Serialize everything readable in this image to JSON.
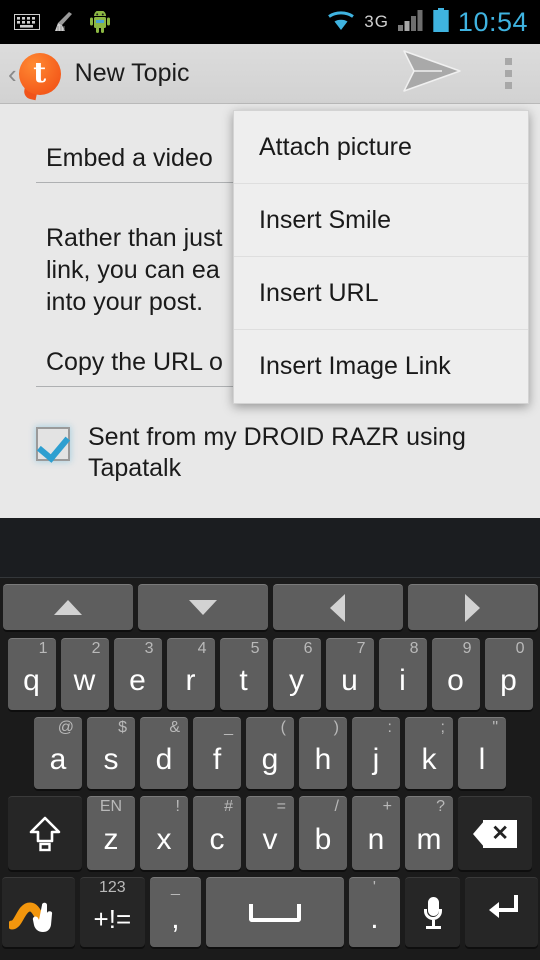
{
  "statusbar": {
    "time": "10:54",
    "icons_left": [
      "keyboard-icon",
      "broom-icon",
      "android-mascot-icon"
    ],
    "icons_right": [
      "wifi-icon",
      "3g-icon",
      "signal-icon",
      "battery-icon"
    ],
    "network_label": "3G",
    "accent_color": "#3fb3e0"
  },
  "actionbar": {
    "back_glyph": "‹",
    "logo_letter": "t",
    "title": "New Topic",
    "send_label": "send-icon",
    "overflow_label": "overflow-icon",
    "brand_color": "#f4591a"
  },
  "compose": {
    "subject": "Embed a video",
    "body_paragraph": "Rather than just\nlink, you can ea\ninto your post.",
    "body_field": "Copy the URL o",
    "signature_text": "Sent from my DROID RAZR using Tapatalk",
    "signature_checked": true
  },
  "overflow_menu": {
    "items": [
      {
        "label": "Attach picture"
      },
      {
        "label": "Insert Smile"
      },
      {
        "label": "Insert URL"
      },
      {
        "label": "Insert Image Link"
      }
    ]
  },
  "keyboard": {
    "nav_row": [
      {
        "name": "arrow-up-key"
      },
      {
        "name": "arrow-down-key"
      },
      {
        "name": "arrow-left-key"
      },
      {
        "name": "arrow-right-key"
      }
    ],
    "row1": [
      {
        "main": "q",
        "hint": "1"
      },
      {
        "main": "w",
        "hint": "2"
      },
      {
        "main": "e",
        "hint": "3"
      },
      {
        "main": "r",
        "hint": "4"
      },
      {
        "main": "t",
        "hint": "5"
      },
      {
        "main": "y",
        "hint": "6"
      },
      {
        "main": "u",
        "hint": "7"
      },
      {
        "main": "i",
        "hint": "8"
      },
      {
        "main": "o",
        "hint": "9"
      },
      {
        "main": "p",
        "hint": "0"
      }
    ],
    "row2": [
      {
        "main": "a",
        "hint": "@"
      },
      {
        "main": "s",
        "hint": "$"
      },
      {
        "main": "d",
        "hint": "&"
      },
      {
        "main": "f",
        "hint": "_"
      },
      {
        "main": "g",
        "hint": "("
      },
      {
        "main": "h",
        "hint": ")"
      },
      {
        "main": "j",
        "hint": ":"
      },
      {
        "main": "k",
        "hint": ";"
      },
      {
        "main": "l",
        "hint": "\""
      }
    ],
    "row3": [
      {
        "main": "z",
        "hint": "EN"
      },
      {
        "main": "x",
        "hint": "!"
      },
      {
        "main": "c",
        "hint": "#"
      },
      {
        "main": "v",
        "hint": "="
      },
      {
        "main": "b",
        "hint": "/"
      },
      {
        "main": "n",
        "hint": "+"
      },
      {
        "main": "m",
        "hint": "?"
      }
    ],
    "shift_key": "shift-key",
    "backspace_key": "backspace-key",
    "row4": {
      "gesture_key": "swipe-gesture-key",
      "symbols_hint": "123",
      "symbols_main": "+!=",
      "comma_hint": "_",
      "comma_main": ",",
      "space_key": "space-key",
      "period_hint": "'",
      "period_main": ".",
      "mic_key": "microphone-key",
      "enter_key": "enter-key"
    }
  }
}
